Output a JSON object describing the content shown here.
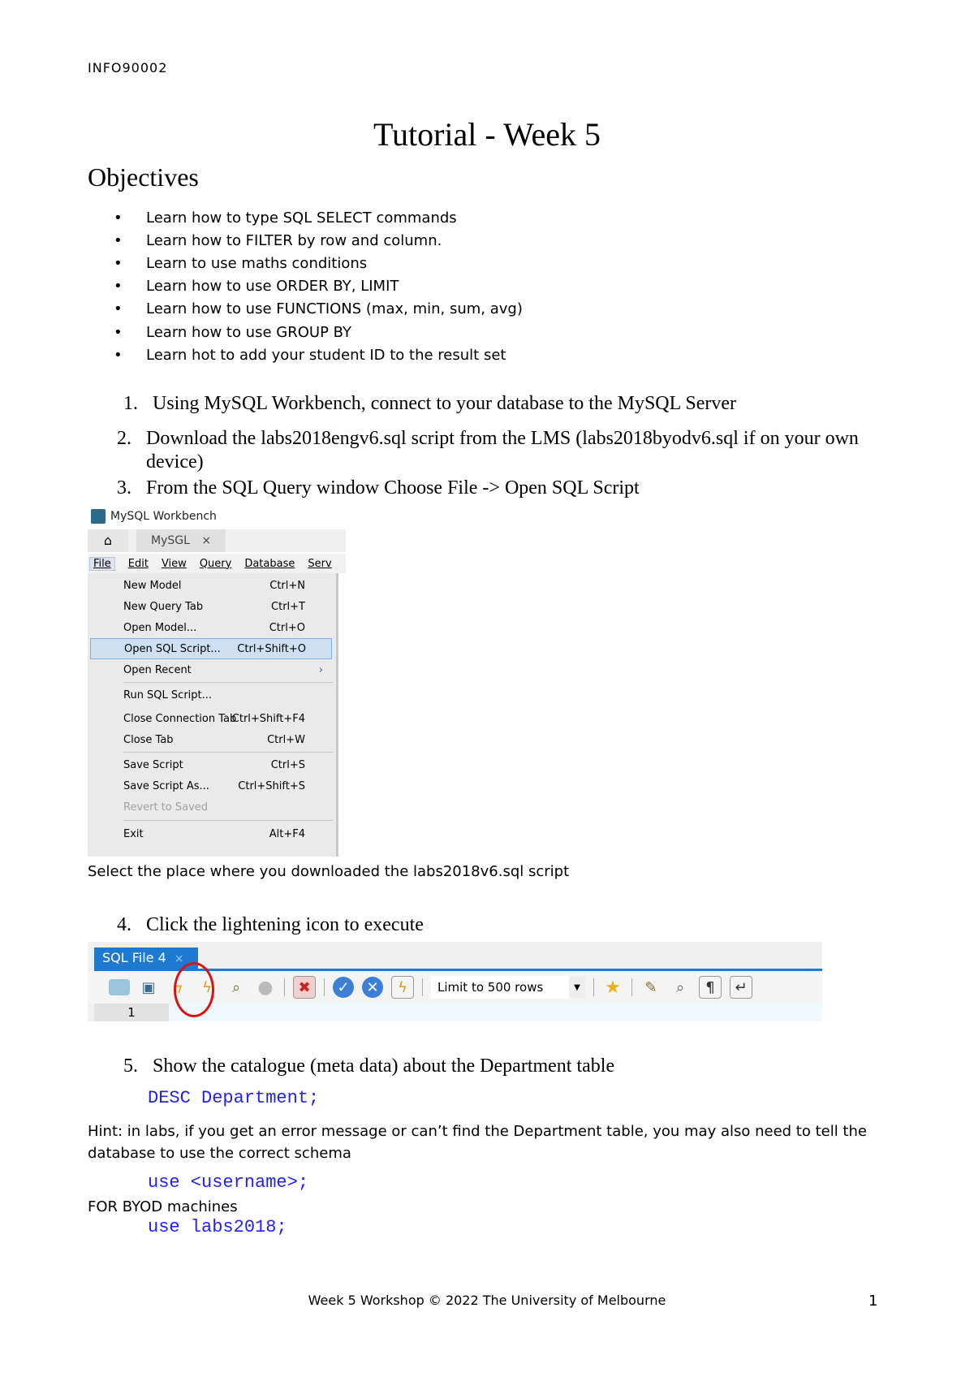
{
  "header": {
    "course_code": "INFO90002"
  },
  "title": "Tutorial - Week 5",
  "objectives": {
    "heading": "Objectives",
    "items": [
      "Learn how to type SQL SELECT commands",
      "Learn how to FILTER by row and column.",
      "Learn to use maths conditions",
      "Learn how to use ORDER BY, LIMIT",
      "Learn how to use FUNCTIONS (max, min, sum, avg)",
      "Learn how to use GROUP BY",
      "Learn hot to add your student ID to the result set"
    ]
  },
  "steps": [
    {
      "num": "1.",
      "text": "Using MySQL Workbench, connect to your database to the MySQL Server"
    },
    {
      "num": "2.",
      "text": "Download the labs2018engv6.sql script from the LMS (labs2018byodv6.sql if on your own device)"
    },
    {
      "num": "3.",
      "text": "From the SQL Query window Choose File -> Open SQL Script"
    },
    {
      "num": "4.",
      "text": "Click the lightening icon to execute"
    },
    {
      "num": "5.",
      "text": "Show the catalogue (meta data) about the Department table"
    }
  ],
  "workbench": {
    "app_title": "MySQL Workbench",
    "tab": "MySGL",
    "menubar": [
      "File",
      "Edit",
      "View",
      "Query",
      "Database",
      "Serv"
    ],
    "file_menu": [
      {
        "label": "New Model",
        "shortcut": "Ctrl+N"
      },
      {
        "label": "New Query Tab",
        "shortcut": "Ctrl+T"
      },
      {
        "label": "Open Model...",
        "shortcut": "Ctrl+O"
      },
      {
        "label": "Open SQL Script...",
        "shortcut": "Ctrl+Shift+O"
      },
      {
        "label": "Open Recent",
        "shortcut": "›"
      },
      {
        "label": "Run SQL Script...",
        "shortcut": ""
      },
      {
        "label": "Close Connection Tab",
        "shortcut": "Ctrl+Shift+F4"
      },
      {
        "label": "Close Tab",
        "shortcut": "Ctrl+W"
      },
      {
        "label": "Save Script",
        "shortcut": "Ctrl+S"
      },
      {
        "label": "Save Script As...",
        "shortcut": "Ctrl+Shift+S"
      },
      {
        "label": "Revert to Saved",
        "shortcut": ""
      },
      {
        "label": "Exit",
        "shortcut": "Alt+F4"
      }
    ]
  },
  "caption_select": "Select the place where you downloaded the labs2018v6.sql script",
  "sqlfile": {
    "tab": "SQL File 4",
    "limit": "Limit to  500 rows",
    "line_number": "1"
  },
  "code": {
    "desc": "DESC Department;",
    "use_username": "use <username>;",
    "use_labs": "use labs2018;"
  },
  "hint": "Hint: in labs, if you get an error message or can’t find the Department table, you may also need to tell the database to use the correct schema",
  "byod_label": "FOR BYOD machines",
  "footer": {
    "text": "Week 5 Workshop © 2022 The University of Melbourne",
    "page": "1"
  }
}
